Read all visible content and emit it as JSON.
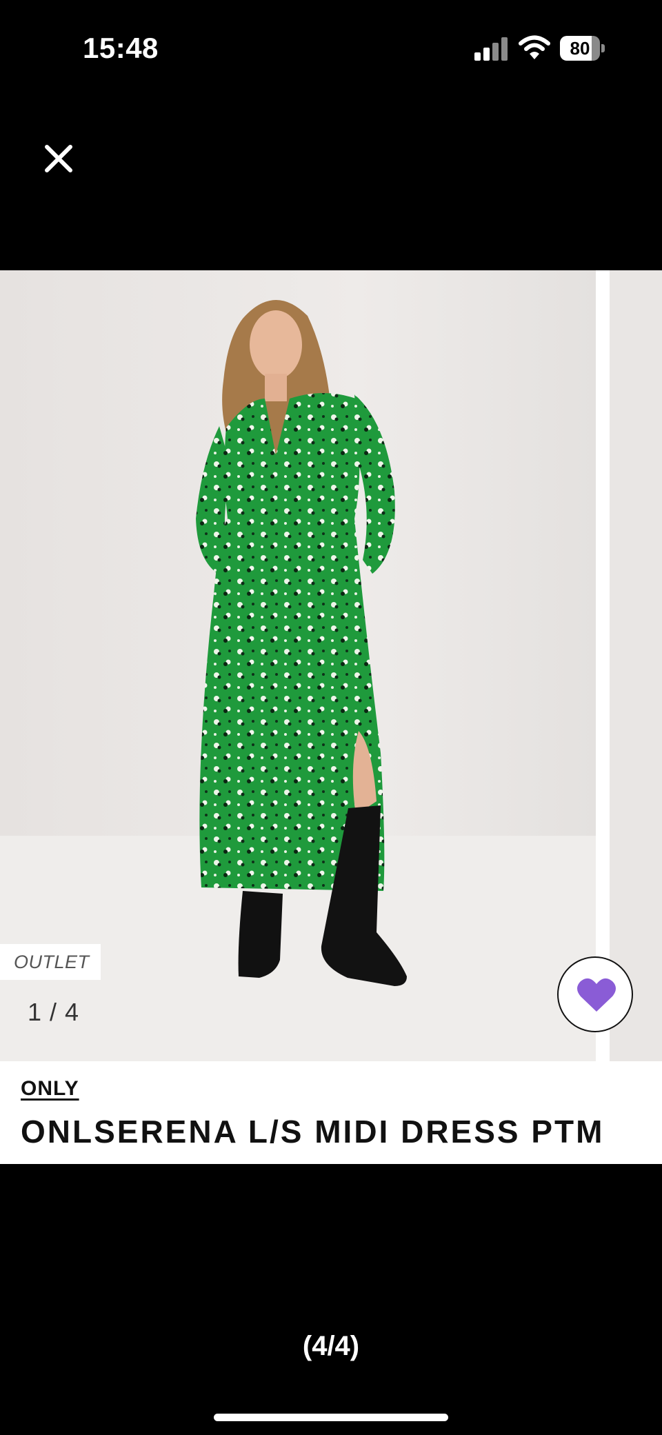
{
  "status_bar": {
    "time": "15:48",
    "battery": "80",
    "battery_level": 0.8
  },
  "icons": {
    "close": "close-icon",
    "favorite": "heart-icon",
    "signal": "cellular-signal-icon",
    "wifi": "wifi-icon",
    "battery": "battery-icon"
  },
  "product": {
    "badge": "OUTLET",
    "image_counter": "1 / 4",
    "brand": "ONLY",
    "name": "ONLSERENA L/S MIDI DRESS PTM"
  },
  "colors": {
    "favorite_heart": "#8a5cd6",
    "dress": "#1e9a3a"
  },
  "page_indicator": "(4/4)"
}
